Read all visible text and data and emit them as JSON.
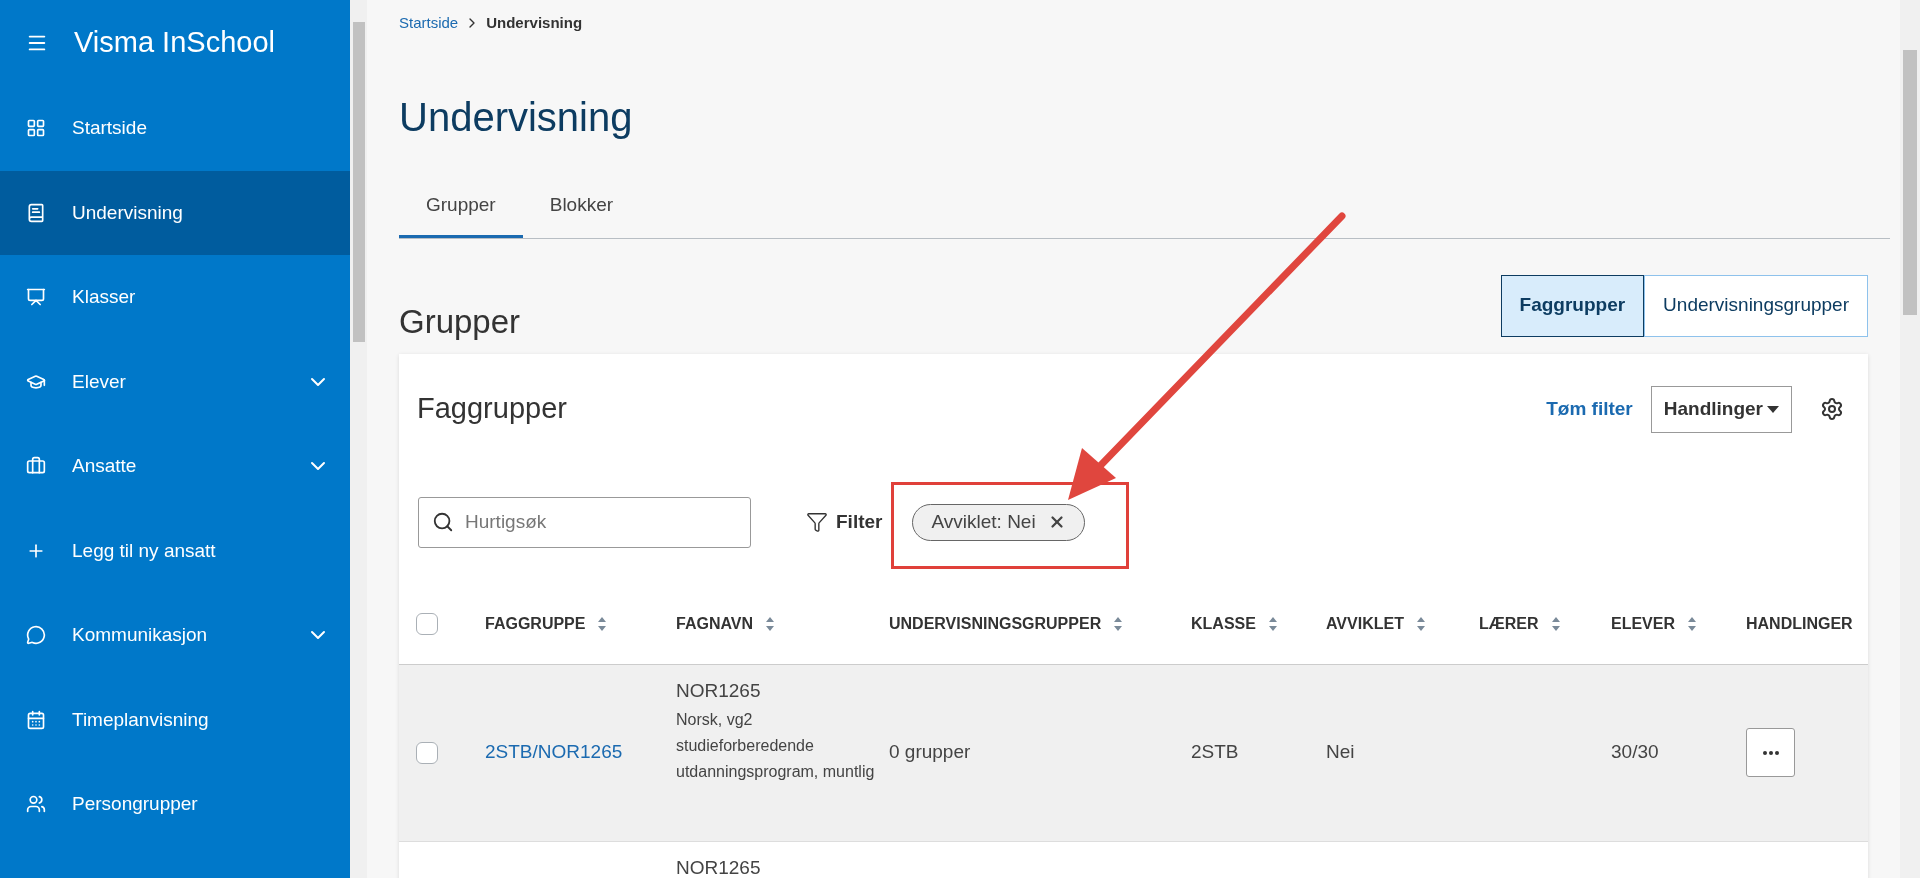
{
  "sidebar": {
    "title": "Visma InSchool",
    "items": [
      {
        "label": "Startside",
        "selected": false,
        "has_submenu": false
      },
      {
        "label": "Undervisning",
        "selected": true,
        "has_submenu": false
      },
      {
        "label": "Klasser",
        "selected": false,
        "has_submenu": false
      },
      {
        "label": "Elever",
        "selected": false,
        "has_submenu": true
      },
      {
        "label": "Ansatte",
        "selected": false,
        "has_submenu": true
      },
      {
        "label": "Legg til ny ansatt",
        "selected": false,
        "has_submenu": false
      },
      {
        "label": "Kommunikasjon",
        "selected": false,
        "has_submenu": true
      },
      {
        "label": "Timeplanvisning",
        "selected": false,
        "has_submenu": false
      },
      {
        "label": "Persongrupper",
        "selected": false,
        "has_submenu": false
      }
    ]
  },
  "breadcrumb": {
    "link": "Startside",
    "current": "Undervisning"
  },
  "page_title": "Undervisning",
  "tabs": [
    {
      "label": "Grupper",
      "selected": true
    },
    {
      "label": "Blokker",
      "selected": false
    }
  ],
  "section_title": "Grupper",
  "toggle": [
    {
      "label": "Faggrupper",
      "selected": true
    },
    {
      "label": "Undervisningsgrupper",
      "selected": false
    }
  ],
  "card": {
    "title": "Faggrupper",
    "clear_filter": "Tøm filter",
    "actions": "Handlinger",
    "search": {
      "placeholder": "Hurtigsøk"
    },
    "filter": "Filter",
    "chips": [
      {
        "label": "Avviklet: Nei"
      }
    ]
  },
  "table": {
    "all_checked": false,
    "columns": [
      {
        "label": "FAGGRUPPE",
        "sortable": true
      },
      {
        "label": "FAGNAVN",
        "sortable": true
      },
      {
        "label": "UNDERVISNINGSGRUPPER",
        "sortable": true
      },
      {
        "label": "KLASSE",
        "sortable": true
      },
      {
        "label": "AVVIKLET",
        "sortable": true
      },
      {
        "label": "LÆRER",
        "sortable": true
      },
      {
        "label": "ELEVER",
        "sortable": true
      },
      {
        "label": "HANDLINGER",
        "sortable": false
      }
    ],
    "rows": [
      {
        "checked": false,
        "highlighted": true,
        "faggruppe": "2STB/NOR1265",
        "code": "NOR1265",
        "description": "Norsk, vg2 studieforberedende utdanningsprogram, muntlig",
        "groups": "0 grupper",
        "klasse": "2STB",
        "avviklet": "Nei",
        "elever": "30/30"
      },
      {
        "highlighted": false,
        "code": "NOR1265"
      }
    ]
  }
}
